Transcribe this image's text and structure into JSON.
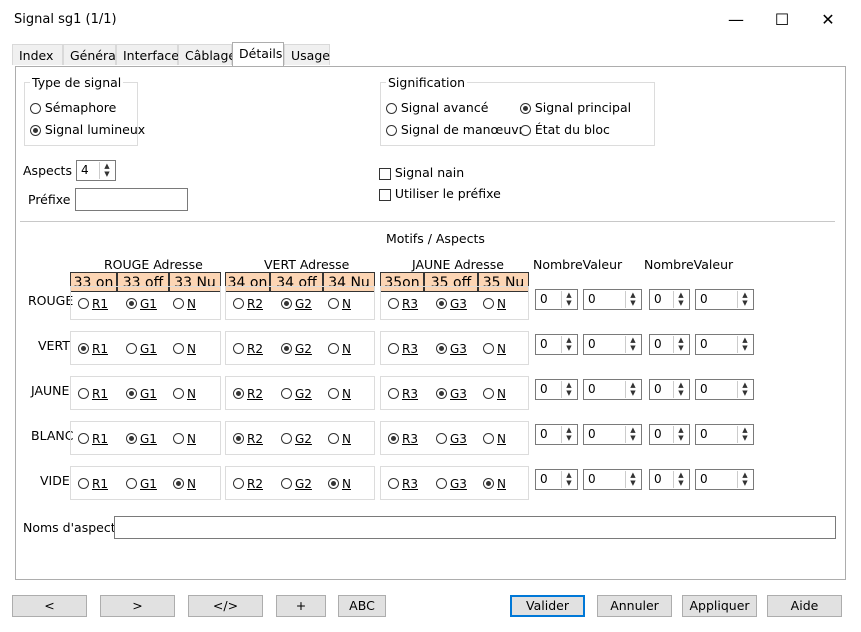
{
  "window": {
    "title": "Signal sg1 (1/1)",
    "minimize": "—",
    "maximize": "☐",
    "close": "✕"
  },
  "tabs": [
    {
      "label": "Index"
    },
    {
      "label": "Général"
    },
    {
      "label": "Interface"
    },
    {
      "label": "Câblage"
    },
    {
      "label": "Détails",
      "active": true
    },
    {
      "label": "Usage"
    }
  ],
  "type_signal": {
    "title": "Type de signal",
    "options": [
      {
        "label": "Sémaphore",
        "selected": false
      },
      {
        "label": "Signal lumineux",
        "selected": true
      }
    ]
  },
  "signification": {
    "title": "Signification",
    "options": [
      {
        "label": "Signal avancé",
        "selected": false
      },
      {
        "label": "Signal principal",
        "selected": true
      },
      {
        "label": "Signal de manœuvre",
        "selected": false
      },
      {
        "label": "État du bloc",
        "selected": false
      }
    ]
  },
  "aspects": {
    "label": "Aspects",
    "value": "4"
  },
  "prefixe": {
    "label": "Préfixe",
    "value": ""
  },
  "signal_nain": {
    "label": "Signal nain",
    "checked": false
  },
  "utiliser_prefixe": {
    "label": "Utiliser le préfixe",
    "checked": false
  },
  "motifs_title": "Motifs / Aspects",
  "groups": [
    {
      "header": "ROUGE Adresse",
      "addr": [
        "33 on",
        "33 off",
        "33 Nu"
      ],
      "opts": [
        "R1",
        "G1",
        "N"
      ]
    },
    {
      "header": "VERT Adresse",
      "addr": [
        "34 on",
        "34 off",
        "34 Nu"
      ],
      "opts": [
        "R2",
        "G2",
        "N"
      ]
    },
    {
      "header": "JAUNE Adresse",
      "addr": [
        "35on",
        "35 off",
        "35 Nu"
      ],
      "opts": [
        "R3",
        "G3",
        "N"
      ]
    }
  ],
  "nv_headers": [
    "NombreValeur",
    "NombreValeur"
  ],
  "rows": [
    {
      "label": "ROUGE",
      "sel": [
        1,
        1,
        1
      ],
      "nums": [
        "0",
        "0",
        "0",
        "0"
      ]
    },
    {
      "label": "VERT",
      "sel": [
        0,
        1,
        1
      ],
      "nums": [
        "0",
        "0",
        "0",
        "0"
      ]
    },
    {
      "label": "JAUNE",
      "sel": [
        1,
        0,
        1
      ],
      "nums": [
        "0",
        "0",
        "0",
        "0"
      ]
    },
    {
      "label": "BLANC",
      "sel": [
        1,
        0,
        0
      ],
      "nums": [
        "0",
        "0",
        "0",
        "0"
      ]
    },
    {
      "label": "VIDE",
      "sel": [
        2,
        2,
        2
      ],
      "nums": [
        "0",
        "0",
        "0",
        "0"
      ]
    }
  ],
  "noms_aspect": {
    "label": "Noms d'aspect",
    "value": ""
  },
  "bottom_buttons": [
    "<",
    ">",
    "</>",
    "+",
    "ABC"
  ],
  "action_buttons": [
    "Valider",
    "Annuler",
    "Appliquer",
    "Aide"
  ]
}
